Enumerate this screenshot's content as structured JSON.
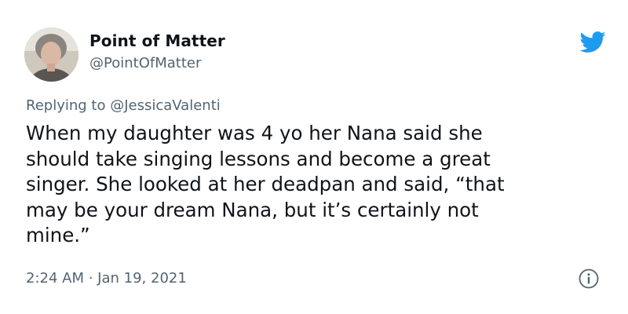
{
  "author": {
    "display_name": "Point of Matter",
    "handle": "@PointOfMatter",
    "avatar_icon": "profile-photo"
  },
  "reply": {
    "prefix": "Replying to ",
    "mention": "@JessicaValenti"
  },
  "tweet": {
    "lines": [
      "When my daughter was 4 yo her Nana said she",
      "should take singing lessons and become a great",
      "singer. She looked at her deadpan and said, “that",
      "may be your dream Nana, but it’s certainly not",
      "mine.”"
    ]
  },
  "meta": {
    "time": "2:24 AM",
    "separator": " · ",
    "date": "Jan 19, 2021"
  },
  "icons": {
    "brand": "twitter-bird-icon",
    "info": "info-icon"
  },
  "colors": {
    "twitter_blue": "#1d9bf0",
    "secondary_text": "#536471",
    "primary_text": "#0f1419"
  }
}
